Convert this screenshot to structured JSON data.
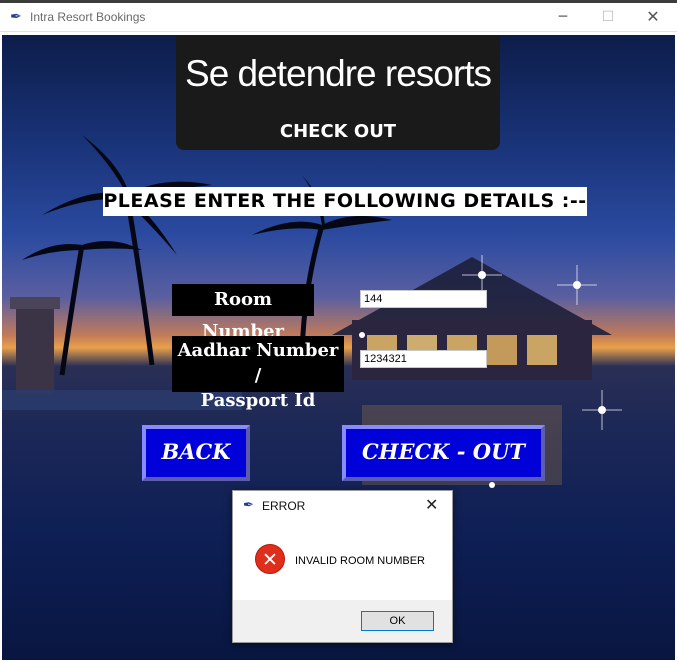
{
  "window": {
    "title": "Intra Resort Bookings",
    "app_icon": "feather-icon",
    "controls": {
      "minimize": "─",
      "maximize": "☐",
      "close": "✕"
    }
  },
  "logo": {
    "name": "Se detendre resorts",
    "subtitle": "CHECK OUT"
  },
  "form": {
    "heading": "PLEASE ENTER THE FOLLOWING DETAILS :--",
    "room_label": "Room Number",
    "room_value": "144",
    "aadhar_label_line1": "Aadhar Number /",
    "aadhar_label_line2": "Passport Id",
    "aadhar_value": "1234321"
  },
  "buttons": {
    "back": "BACK",
    "checkout": "CHECK - OUT"
  },
  "dialog": {
    "title": "ERROR",
    "icon": "error-icon",
    "close": "✕",
    "message": "INVALID ROOM NUMBER",
    "ok": "OK"
  },
  "colors": {
    "button_blue": "#0000d8",
    "label_black": "#000000",
    "error_red": "#e02e1c",
    "ok_border": "#0078d7"
  }
}
